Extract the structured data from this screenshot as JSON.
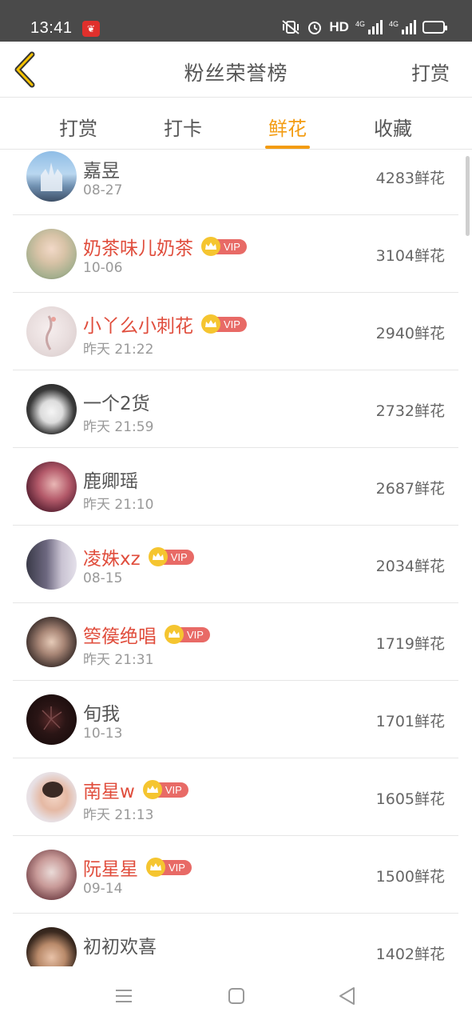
{
  "status": {
    "time": "13:41",
    "hd": "HD",
    "net1": "4G",
    "net2": "4G"
  },
  "header": {
    "title": "粉丝荣誉榜",
    "action": "打赏"
  },
  "tabs": [
    {
      "label": "打赏",
      "active": false
    },
    {
      "label": "打卡",
      "active": false
    },
    {
      "label": "鲜花",
      "active": true
    },
    {
      "label": "收藏",
      "active": false
    }
  ],
  "vip_label": "VIP",
  "list": [
    {
      "name": "嘉昱",
      "date": "08-27",
      "count": "4283鲜花",
      "vip": false
    },
    {
      "name": "奶茶味儿奶茶",
      "date": "10-06",
      "count": "3104鲜花",
      "vip": true
    },
    {
      "name": "小丫么小刺花",
      "date": "昨天 21:22",
      "count": "2940鲜花",
      "vip": true
    },
    {
      "name": "一个2货",
      "date": "昨天 21:59",
      "count": "2732鲜花",
      "vip": false
    },
    {
      "name": "鹿卿瑶",
      "date": "昨天 21:10",
      "count": "2687鲜花",
      "vip": false
    },
    {
      "name": "凌姝xz",
      "date": "08-15",
      "count": "2034鲜花",
      "vip": true
    },
    {
      "name": "箜篌绝唱",
      "date": "昨天 21:31",
      "count": "1719鲜花",
      "vip": true
    },
    {
      "name": "旬我",
      "date": "10-13",
      "count": "1701鲜花",
      "vip": false
    },
    {
      "name": "南星w",
      "date": "昨天 21:13",
      "count": "1605鲜花",
      "vip": true
    },
    {
      "name": "阮星星",
      "date": "09-14",
      "count": "1500鲜花",
      "vip": true
    },
    {
      "name": "初初欢喜",
      "date": "",
      "count": "1402鲜花",
      "vip": false
    }
  ],
  "colors": {
    "accent": "#f39c12",
    "vip_name": "#e04d3c",
    "vip_tag": "#e86a66",
    "crown": "#f5c530"
  }
}
